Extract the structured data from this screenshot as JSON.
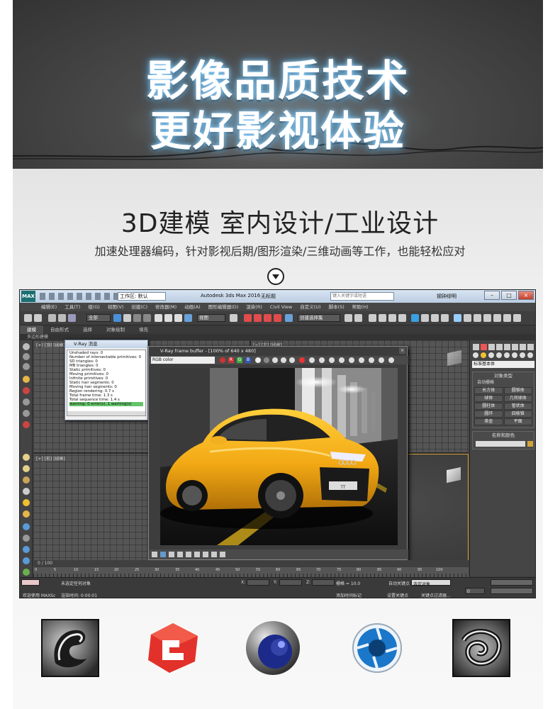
{
  "hero": {
    "line1": "影像品质技术",
    "line2": "更好影视体验"
  },
  "headline": "3D建模 室内设计/工业设计",
  "subline": "加速处理器编码，针对影视后期/图形渲染/三维动画等工作，也能轻松应对",
  "app": {
    "logo": "MAX",
    "workspace": "工作区: 默认",
    "title": "Autodesk 3ds Max 2016",
    "file": "无标题",
    "search_placeholder": "键入关键字或短语",
    "user": "钢钟缪明",
    "menus": [
      "编辑(E)",
      "工具(T)",
      "组(G)",
      "视图(V)",
      "创建(C)",
      "修改器(M)",
      "动画(A)",
      "图形编辑器(D)",
      "渲染(R)",
      "Civil View",
      "自定义(U)",
      "脚本(S)",
      "帮助(H)"
    ],
    "toolbar": {
      "filter": "全部",
      "view": "视图",
      "named_sel": "创建选择集"
    },
    "ribbon_tabs": [
      "建模",
      "自由形式",
      "选择",
      "对象绘制",
      "填充"
    ],
    "sub_ribbon": "多边形建模",
    "viewport_labels": {
      "top": "[+] [顶] [线框]",
      "front": "[+] [前] [线框]",
      "left": "[+] [左] [线框]"
    },
    "command_panel": {
      "category": "标准基本体",
      "object_type_title": "对象类型",
      "autogrid": "自动栅格",
      "objects": [
        "长方体",
        "圆锥体",
        "球体",
        "几何球体",
        "圆柱体",
        "管状体",
        "圆环",
        "四棱锥",
        "茶壶",
        "平面"
      ],
      "name_color_title": "名称和颜色"
    },
    "vray_msg": {
      "title": "V-Ray 消息",
      "lines": [
        "Unshaded rays: 0",
        "Number of intersectable primitives: 0",
        "SD triangles: 0",
        "MB triangles: 0",
        "Static primitives: 0",
        "Moving primitives: 0",
        "Infinite primitives: 0",
        "Static hair segments: 0",
        "Moving hair segments: 0",
        "Region rendering: 0.7 s",
        "Total frame time: 1.3 s",
        "Total sequence time: 1.4 s",
        "warning: 0 error(s), 1 warning(s)"
      ]
    },
    "frame_buffer": {
      "title": "V-Ray frame buffer - [100% of 640 x 480]",
      "channel": "RGB color",
      "channels": [
        "R",
        "G",
        "B"
      ],
      "car_plate": "TT"
    },
    "timeline": "0 / 100",
    "ruler_ticks": [
      "0",
      "5",
      "10",
      "15",
      "20",
      "25",
      "30",
      "35",
      "40",
      "45",
      "50",
      "55",
      "60",
      "65",
      "70",
      "75",
      "80",
      "85",
      "90",
      "95",
      "100"
    ],
    "status": {
      "selection": "未选定任何对象",
      "render_time": "渲染时间: 0:00:01",
      "welcome": "欢迎使用 MAXSc",
      "x_label": "X:",
      "y_label": "Y:",
      "z_label": "Z:",
      "grid": "栅格 = 10.0",
      "add_time_tag": "添加时间标记",
      "auto_key": "自动关键点",
      "set_key": "设置关键点",
      "selected_obj": "选定对象",
      "key_filter": "关键点过滤器...",
      "frame": "0"
    }
  },
  "colors": {
    "accent": "#1d6f70",
    "sketchup": "#e2312a",
    "cinema4d": "#3244a8",
    "keyshot": "#1a77c9"
  },
  "logos": [
    "3ds-max-logo",
    "sketchup-logo",
    "cinema4d-logo",
    "keyshot-logo",
    "maya-logo"
  ]
}
